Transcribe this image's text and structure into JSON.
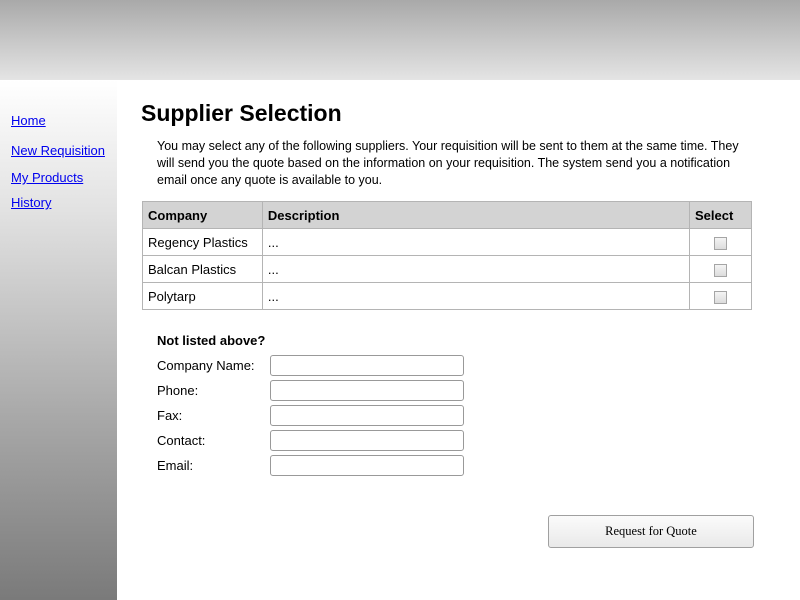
{
  "nav": {
    "home": "Home",
    "new_requisition": "New Requisition",
    "my_products": "My Products",
    "history": "History"
  },
  "main": {
    "title": "Supplier Selection",
    "intro": "You may select any of the following suppliers. Your requisition will be sent to them at the same time. They will send you the quote based on the information on your requisition. The system send you a notification email once any quote is available to you."
  },
  "table": {
    "headers": [
      "Company",
      "Description",
      "Select"
    ],
    "rows": [
      {
        "company": "Regency Plastics",
        "description": "...",
        "selected": false
      },
      {
        "company": "Balcan Plastics",
        "description": "...",
        "selected": false
      },
      {
        "company": "Polytarp",
        "description": "...",
        "selected": false
      }
    ]
  },
  "form": {
    "heading": "Not listed above?",
    "fields": [
      {
        "label": "Company Name:",
        "value": ""
      },
      {
        "label": "Phone:",
        "value": ""
      },
      {
        "label": "Fax:",
        "value": ""
      },
      {
        "label": "Contact:",
        "value": ""
      },
      {
        "label": "Email:",
        "value": ""
      }
    ]
  },
  "actions": {
    "request_quote": "Request for Quote"
  },
  "colors": {
    "link": "#0000ee",
    "table_header": "#d3d3d3",
    "border": "#b4b4b4"
  }
}
